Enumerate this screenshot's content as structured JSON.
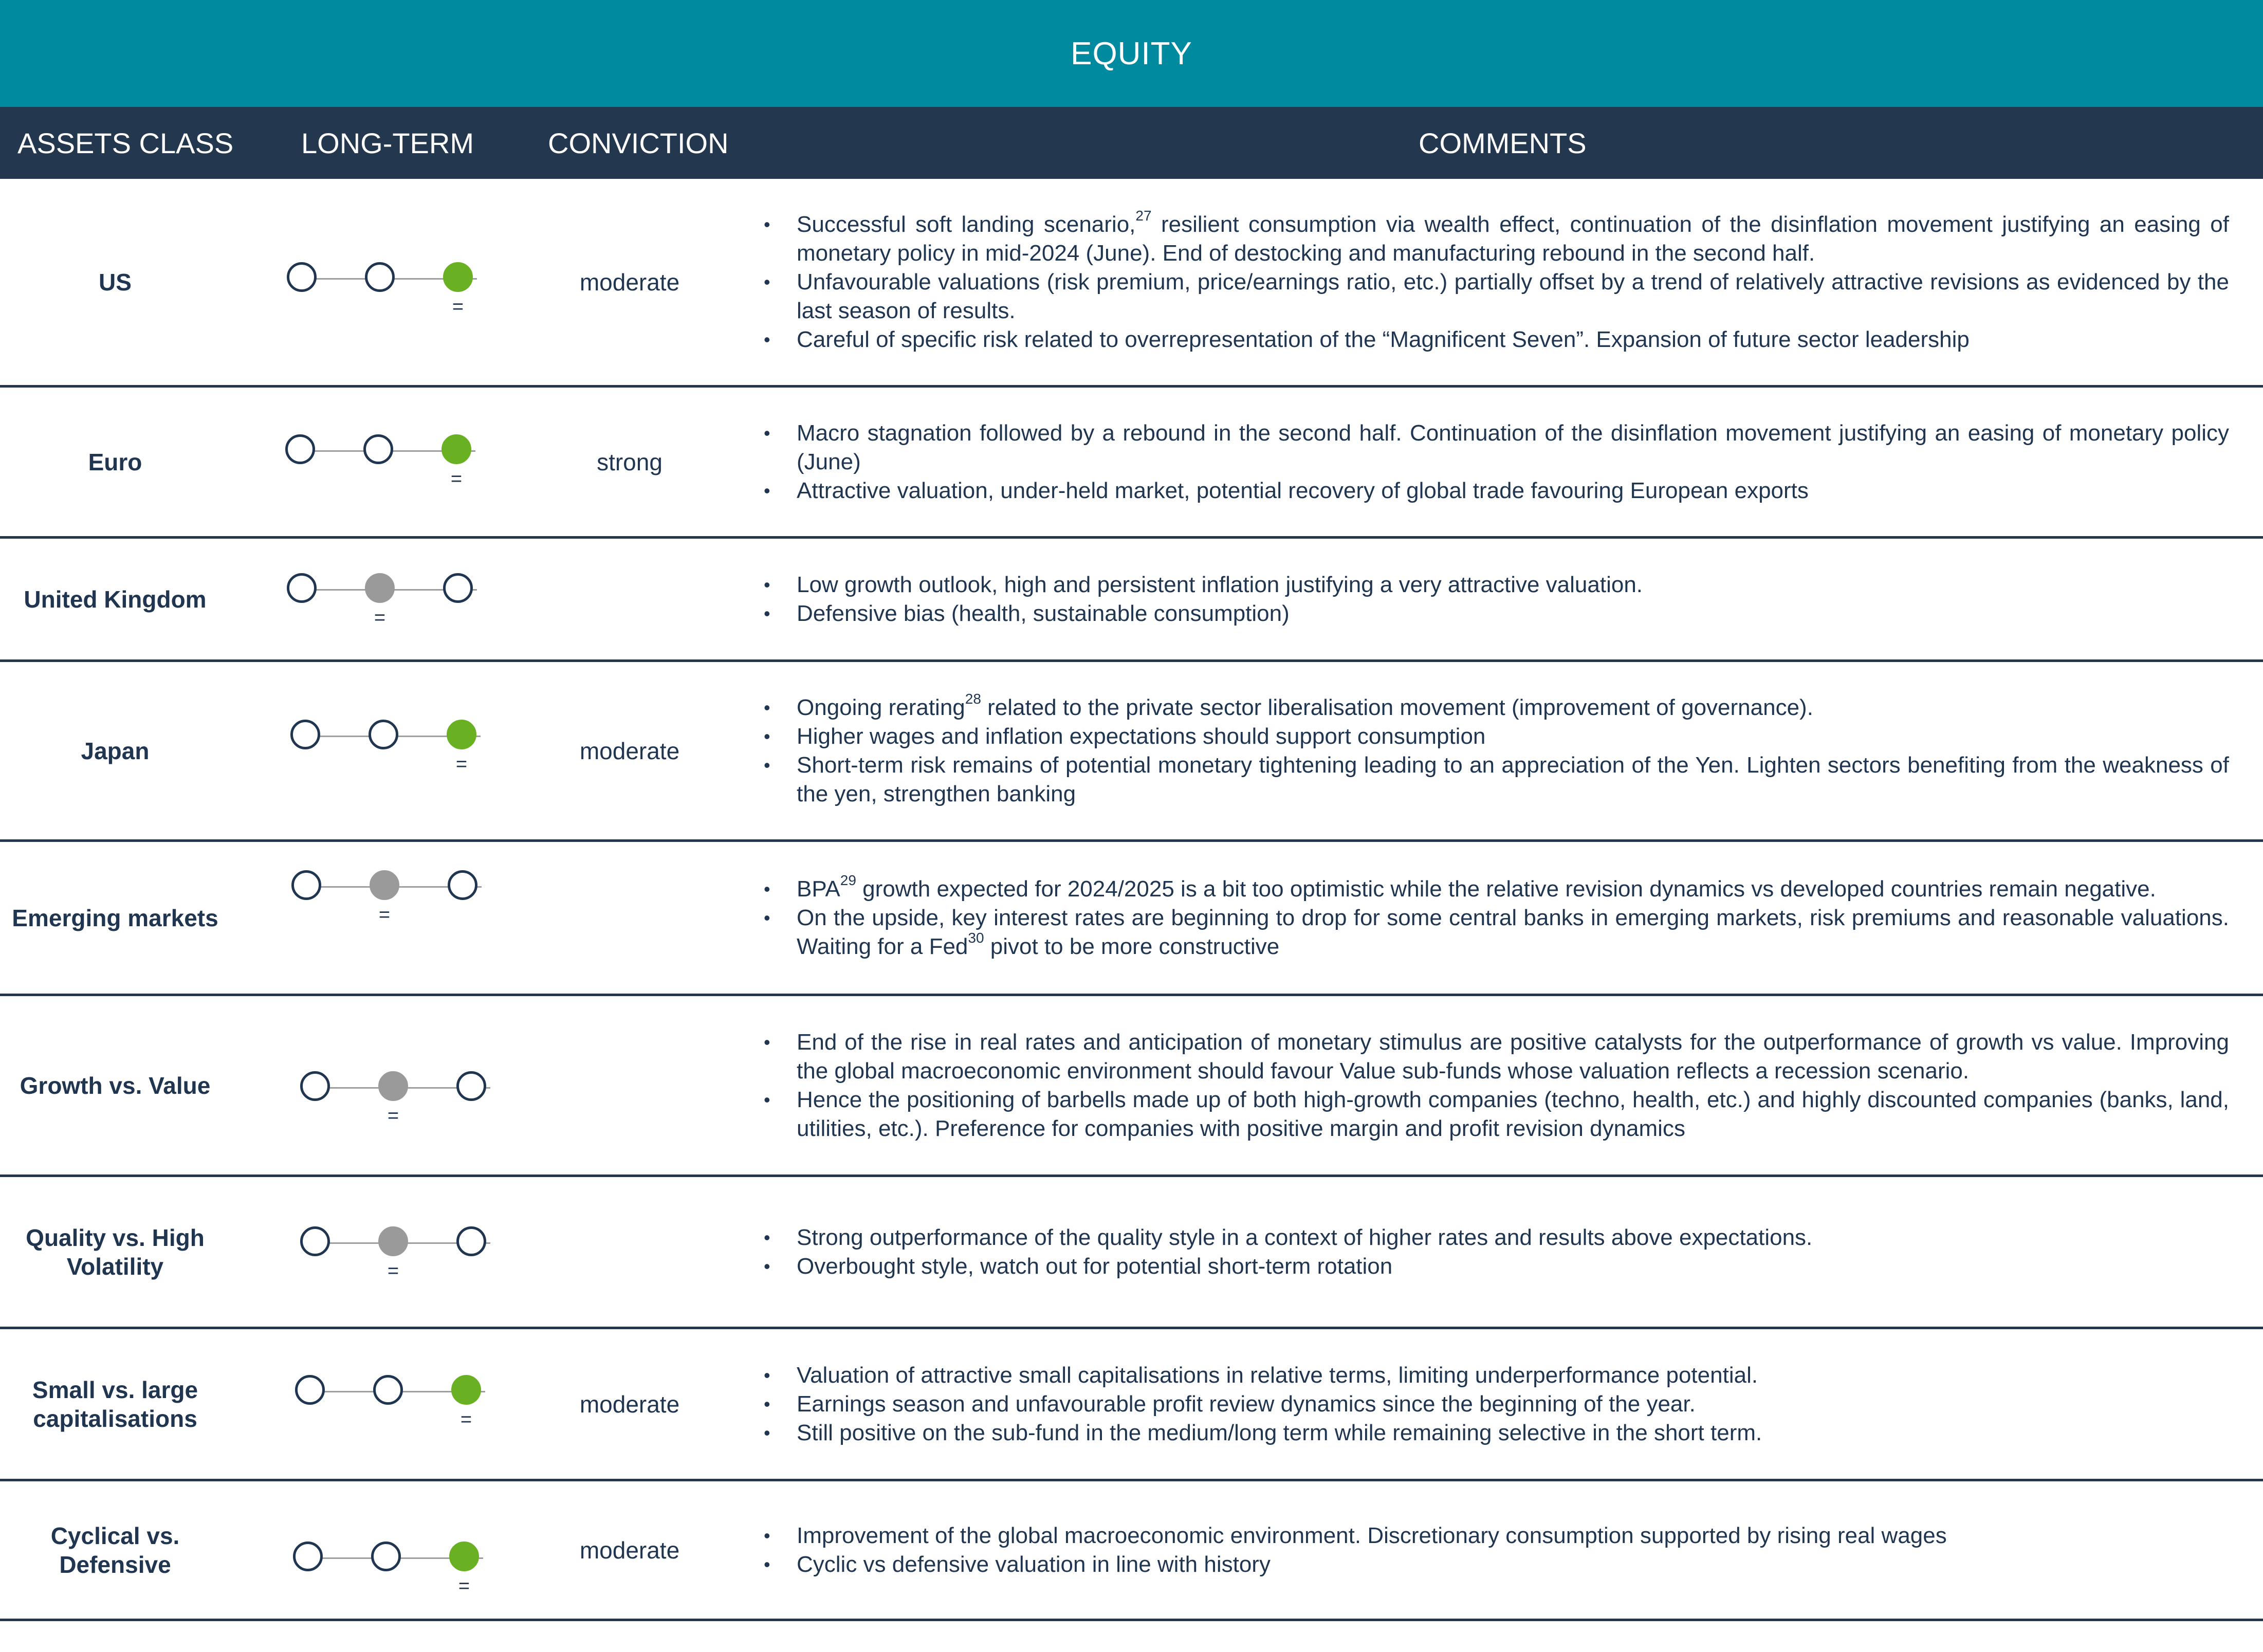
{
  "title": "EQUITY",
  "columns": {
    "asset": "ASSETS CLASS",
    "long_term": "LONG-TERM",
    "conviction": "CONVICTION",
    "comments": "COMMENTS"
  },
  "colors": {
    "banner": "#008aa0",
    "header": "#23374e",
    "positive_dot": "#6ab023",
    "neutral_dot": "#9a9a9a"
  },
  "rows": [
    {
      "asset": "US",
      "position": 2,
      "position_label": "positive",
      "trend": "=",
      "conviction": "moderate",
      "comments": [
        {
          "pre": "Successful soft landing scenario,",
          "sup": "27",
          "post": " resilient consumption via wealth effect, continuation of the disinflation movement justifying an easing of monetary policy in mid-2024 (June). End of destocking and manufacturing rebound in the second half."
        },
        {
          "pre": "Unfavourable valuations (risk premium, price/earnings ratio, etc.) partially offset by a trend of relatively attractive revisions as evidenced by the last season of results.",
          "sup": "",
          "post": ""
        },
        {
          "pre": "Careful of specific risk related to overrepresentation of the “Magnificent Seven”. Expansion of future sector leadership",
          "sup": "",
          "post": ""
        }
      ]
    },
    {
      "asset": "Euro",
      "position": 2,
      "position_label": "positive",
      "trend": "=",
      "conviction": "strong",
      "comments": [
        {
          "pre": "Macro stagnation followed by a rebound in the second half. Continuation of the disinflation movement justifying an easing of monetary policy (June)",
          "sup": "",
          "post": ""
        },
        {
          "pre": "Attractive valuation, under-held market, potential recovery of global trade favouring European exports",
          "sup": "",
          "post": ""
        }
      ]
    },
    {
      "asset": "United Kingdom",
      "position": 1,
      "position_label": "neutral",
      "trend": "=",
      "conviction": "",
      "comments": [
        {
          "pre": "Low growth outlook, high and persistent inflation justifying a very attractive valuation.",
          "sup": "",
          "post": ""
        },
        {
          "pre": "Defensive bias (health, sustainable consumption)",
          "sup": "",
          "post": ""
        }
      ]
    },
    {
      "asset": "Japan",
      "position": 2,
      "position_label": "positive",
      "trend": "=",
      "conviction": "moderate",
      "comments": [
        {
          "pre": "Ongoing rerating",
          "sup": "28",
          "post": " related to the private sector liberalisation movement (improvement of governance)."
        },
        {
          "pre": "Higher wages and inflation expectations should support consumption",
          "sup": "",
          "post": ""
        },
        {
          "pre": "Short-term risk remains of potential monetary tightening leading to an appreciation of the Yen. Lighten sectors benefiting from the weakness of the yen, strengthen banking",
          "sup": "",
          "post": ""
        }
      ]
    },
    {
      "asset": "Emerging markets",
      "position": 1,
      "position_label": "neutral",
      "trend": "=",
      "conviction": "",
      "comments": [
        {
          "pre": "BPA",
          "sup": "29",
          "post": " growth expected for 2024/2025 is a bit too optimistic while the relative revision dynamics vs developed countries remain negative."
        },
        {
          "pre": "On the upside, key interest rates are beginning to drop for some central banks in emerging markets, risk premiums and reasonable valuations. Waiting for a Fed",
          "sup": "30",
          "post": " pivot to be more constructive"
        }
      ]
    },
    {
      "asset": "Growth vs. Value",
      "position": 1,
      "position_label": "neutral",
      "trend": "=",
      "conviction": "",
      "comments": [
        {
          "pre": "End of the rise in real rates and anticipation of monetary stimulus are positive catalysts for the outperformance of growth vs value. Improving the global macroeconomic environment should favour Value sub-funds whose valuation reflects a recession scenario.",
          "sup": "",
          "post": ""
        },
        {
          "pre": "Hence the positioning of barbells made up of both high-growth companies (techno, health, etc.) and highly discounted companies (banks, land, utilities, etc.). Preference for companies with positive margin and profit revision dynamics",
          "sup": "",
          "post": ""
        }
      ]
    },
    {
      "asset": "Quality vs. High Volatility",
      "position": 1,
      "position_label": "neutral",
      "trend": "=",
      "conviction": "",
      "comments": [
        {
          "pre": "Strong outperformance of the quality style in a context of higher rates and results above expectations.",
          "sup": "",
          "post": ""
        },
        {
          "pre": "Overbought style, watch out for potential short-term rotation",
          "sup": "",
          "post": ""
        }
      ]
    },
    {
      "asset": "Small vs. large capitalisations",
      "position": 2,
      "position_label": "positive",
      "trend": "=",
      "conviction": "moderate",
      "comments": [
        {
          "pre": "Valuation of attractive small capitalisations in relative terms, limiting underperformance potential.",
          "sup": "",
          "post": ""
        },
        {
          "pre": "Earnings season and unfavourable profit review dynamics since the beginning of the year.",
          "sup": "",
          "post": ""
        },
        {
          "pre": "Still positive on the sub-fund in the medium/long term while remaining selective in the short term.",
          "sup": "",
          "post": ""
        }
      ]
    },
    {
      "asset": "Cyclical vs. Defensive",
      "position": 2,
      "position_label": "positive",
      "trend": "=",
      "conviction": "moderate",
      "comments": [
        {
          "pre": "Improvement of the global macroeconomic environment. Discretionary consumption supported by rising real wages",
          "sup": "",
          "post": ""
        },
        {
          "pre": "Cyclic vs defensive valuation in line with history",
          "sup": "",
          "post": ""
        }
      ]
    }
  ]
}
